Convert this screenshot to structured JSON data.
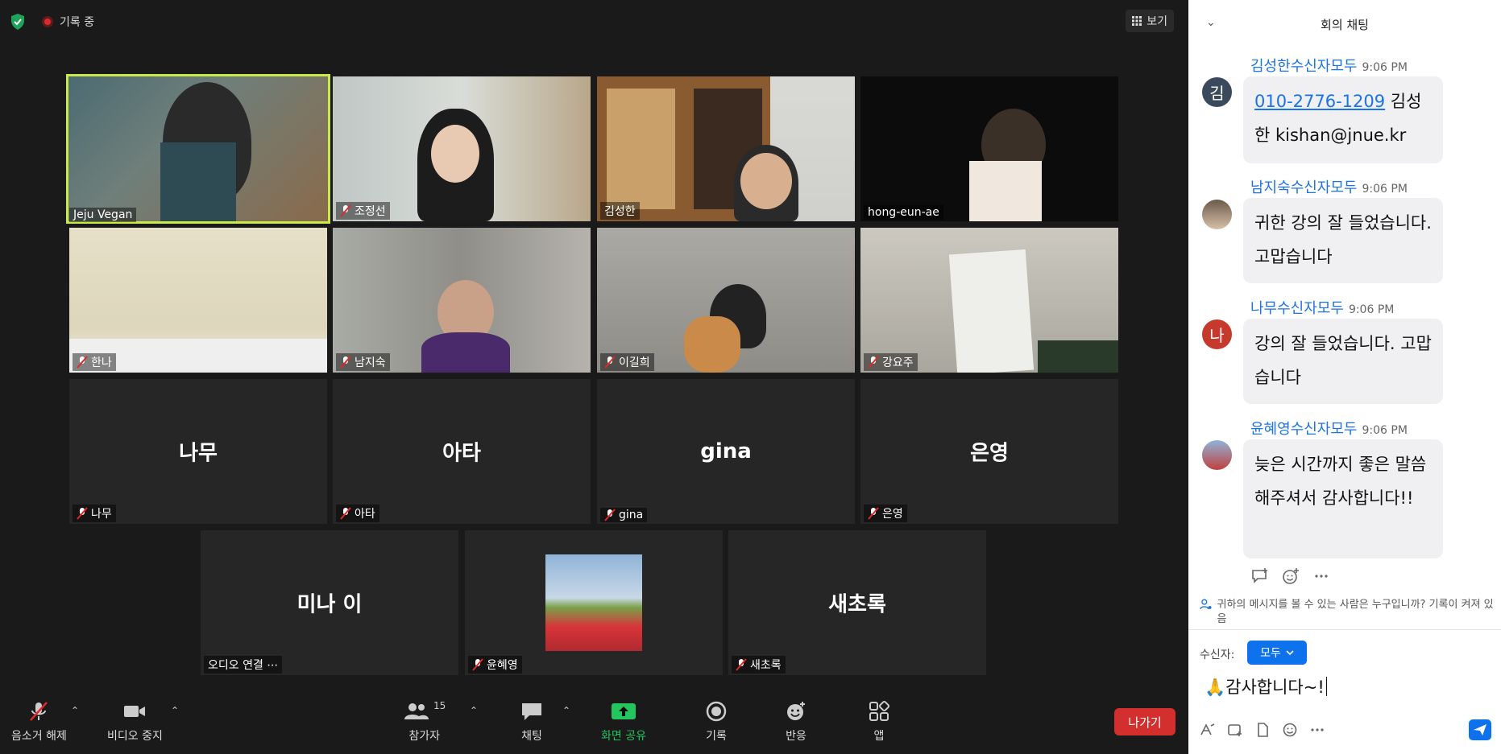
{
  "top": {
    "recording_label": "기록 중",
    "view_label": "보기"
  },
  "tiles": [
    {
      "name": "Jeju Vegan"
    },
    {
      "name": "조정선"
    },
    {
      "name": "김성한"
    },
    {
      "name": "hong-eun-ae"
    },
    {
      "name": "한나"
    },
    {
      "name": "남지숙"
    },
    {
      "name": "이길희"
    },
    {
      "name": "강요주"
    },
    {
      "big": "나무",
      "name": "나무"
    },
    {
      "big": "아타",
      "name": "아타"
    },
    {
      "big": "gina",
      "name": "gina"
    },
    {
      "big": "은영",
      "name": "은영"
    },
    {
      "big": "미나 이",
      "name": "오디오 연결 ⋯"
    },
    {
      "name": "윤혜영"
    },
    {
      "big": "새초록",
      "name": "새초록"
    }
  ],
  "toolbar": {
    "unmute": "음소거 해제",
    "stop_video": "비디오 중지",
    "participants": "참가자",
    "participants_count": "15",
    "chat": "채팅",
    "share": "화면 공유",
    "record": "기록",
    "reactions": "반응",
    "apps": "앱",
    "leave": "나가기"
  },
  "colors": {
    "accent": "#0e72ed",
    "share_green": "#22c55e",
    "leave_red": "#d32f2f",
    "active_speaker": "#c9e84a"
  },
  "chat": {
    "title": "회의 채팅",
    "messages": [
      {
        "sender": "김성한",
        "recipient": "수신자",
        "to": "모두",
        "time": "9:06 PM",
        "avatar_letter": "김",
        "phone": "010-2776-1209",
        "text_rest": " 김성한 kishan@jnue.kr"
      },
      {
        "sender": "남지숙",
        "recipient": "수신자",
        "to": "모두",
        "time": "9:06 PM",
        "text": "귀한 강의 잘 들었습니다. 고맙습니다"
      },
      {
        "sender": "나무",
        "recipient": "수신자",
        "to": "모두",
        "time": "9:06 PM",
        "avatar_letter": "나",
        "text": "강의 잘 들었습니다. 고맙습니다"
      },
      {
        "sender": "윤혜영",
        "recipient": "수신자",
        "to": "모두",
        "time": "9:06 PM",
        "text": "늦은 시간까지 좋은 말씀해주셔서 감사합니다!!"
      }
    ],
    "notice": "귀하의 메시지를 볼 수 있는 사람은 누구입니까? 기록이 켜져 있음",
    "to_label": "수신자:",
    "to_value": "모두",
    "input_value": "🙏감사합니다~!"
  }
}
